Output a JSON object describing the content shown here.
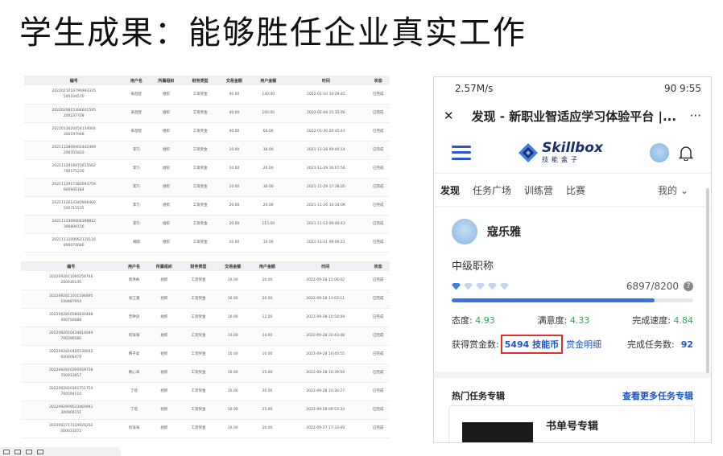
{
  "slide": {
    "title": "学生成果：能够胜任企业真实工作"
  },
  "table_top": {
    "columns": [
      "编号",
      "用户名",
      "所属组织",
      "财务类型",
      "交易金额",
      "用户金额",
      "时间",
      "状态"
    ],
    "rows": [
      [
        "2022021016796993335 500104570",
        "宋昌智",
        "组织",
        "工资奖金",
        "40.00",
        "140.00",
        "2022-02-10 14:29:45",
        "已完成"
      ],
      [
        "2022020815304641595 200237728",
        "宋昌智",
        "组织",
        "工资奖金",
        "40.00",
        "100.00",
        "2022-02-08 15:35:46",
        "已完成"
      ],
      [
        "2022013020454134004 300197948",
        "宋昌智",
        "组织",
        "工资奖金",
        "40.00",
        "60.00",
        "2022-01-30 20:45:41",
        "已完成"
      ],
      [
        "2021112809401442499 200701820",
        "李乃",
        "组织",
        "工资奖金",
        "10.00",
        "30.00",
        "2021-11-28 09:40:14",
        "已完成"
      ],
      [
        "2021112916075615562 700175230",
        "李乃",
        "组织",
        "工资奖金",
        "10.00",
        "20.00",
        "2021-11-29 16:07:56",
        "已完成"
      ],
      [
        "2021112917382093759 800945184",
        "李乃",
        "组织",
        "工资奖金",
        "10.00",
        "30.00",
        "2021-11-29 17:38:20",
        "已完成"
      ],
      [
        "2021112614340906400 500715535",
        "李乃",
        "组织",
        "工资奖金",
        "20.00",
        "20.00",
        "2021-11-26 14:34:09",
        "已完成"
      ],
      [
        "2021111309404398812 300800156",
        "李乃",
        "组织",
        "工资奖金",
        "20.00",
        "115.00",
        "2021-11-13 09:40:43",
        "已完成"
      ],
      [
        "2021111109062120118 800074686",
        "胡圆",
        "组织",
        "工资奖金",
        "10.00",
        "10.00",
        "2021-11-11 09:06:21",
        "已完成"
      ]
    ]
  },
  "table_bottom": {
    "columns": [
      "编号",
      "用户名",
      "所属组织",
      "财务类型",
      "交易金额",
      "用户金额",
      "时间",
      "状态"
    ],
    "rows": [
      [
        "2022092811060250746 200930145",
        "周洪奇",
        "组织",
        "工资奖金",
        "10.00",
        "10.00",
        "2022-09-28 11:06:02",
        "已完成"
      ],
      [
        "2022092811031186895 100487954",
        "张江潼",
        "组织",
        "工资奖金",
        "10.00",
        "20.00",
        "2022-09-28 11:03:11",
        "已完成"
      ],
      [
        "2022092810580830488 400750088",
        "曾钟语",
        "组织",
        "工资奖金",
        "10.00",
        "12.00",
        "2022-09-28 10:58:08",
        "已完成"
      ],
      [
        "2022092810434814049 700296580",
        "何涛海",
        "组织",
        "工资奖金",
        "10.00",
        "24.00",
        "2022-09-28 10:43:48",
        "已完成"
      ],
      [
        "2022092810405530042 600406479",
        "韩子高",
        "组织",
        "工资奖金",
        "10.00",
        "10.00",
        "2022-09-28 10:40:55",
        "已完成"
      ],
      [
        "2022092810395959738 700913057",
        "韩心泽",
        "组织",
        "工资奖金",
        "10.00",
        "15.00",
        "2022-09-28 10:39:59",
        "已完成"
      ],
      [
        "2022092810302751754 700594110",
        "丁欢",
        "组织",
        "工资奖金",
        "10.00",
        "20.00",
        "2022-09-28 10:30:27",
        "已完成"
      ],
      [
        "2022092809533460941 300904151",
        "丁欢",
        "组织",
        "工资奖金",
        "10.00",
        "25.00",
        "2022-09-28 09:53:34",
        "已完成"
      ],
      [
        "2022092717334926262 000031072",
        "何涛海",
        "组织",
        "工资奖金",
        "10.00",
        "10.00",
        "2022-09-27 17:33:49",
        "已完成"
      ]
    ]
  },
  "phone": {
    "status": {
      "left": "2.57M/s",
      "right": "90 9:55"
    },
    "nav": {
      "close": "✕",
      "title": "发现 - 新职业智适应学习体验平台 |...",
      "more": "···"
    },
    "logo": {
      "brand": "Skillbox",
      "sub": "技能盒子"
    },
    "tabs": [
      "发现",
      "任务广场",
      "训练营",
      "比赛"
    ],
    "tab_mine": "我的",
    "profile": {
      "name": "寇乐雅",
      "level": "中级职称",
      "score": "6897/8200",
      "progress": 0.84,
      "gems_on": 1,
      "gems_total": 5,
      "attitude_label": "态度:",
      "attitude": "4.93",
      "satisfaction_label": "满意度:",
      "satisfaction": "4.33",
      "speed_label": "完成速度:",
      "speed": "4.84",
      "reward_label": "获得赏金数:",
      "reward": "5494 技能币",
      "reward_detail": "赏金明细",
      "tasks_label": "完成任务数:",
      "tasks": "92"
    },
    "hot": {
      "title": "热门任务专辑",
      "more": "查看更多任务专辑",
      "card_title": "书单号专辑"
    }
  }
}
